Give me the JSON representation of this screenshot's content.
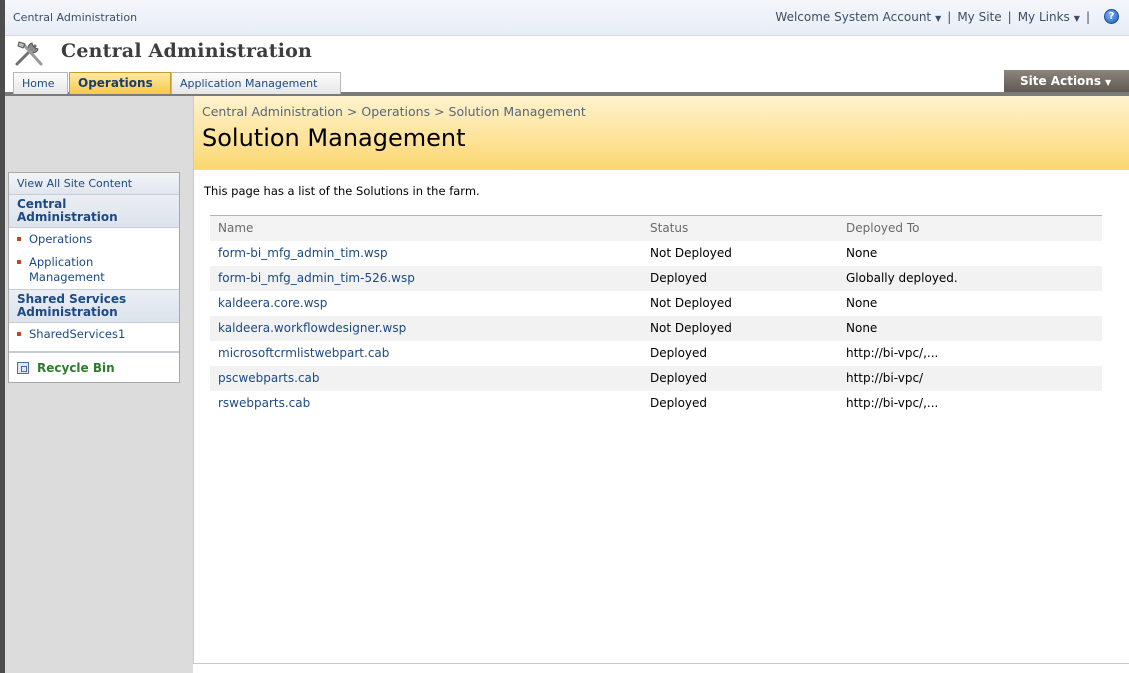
{
  "globalbar": {
    "site_name": "Central Administration",
    "welcome": "Welcome System Account",
    "my_site": "My Site",
    "my_links": "My Links",
    "separator": "|",
    "help_glyph": "?"
  },
  "header": {
    "title": "Central Administration",
    "logo_icon": "tools-icon"
  },
  "tabs": [
    {
      "label": "Home",
      "selected": false
    },
    {
      "label": "Operations",
      "selected": true
    },
    {
      "label": "Application Management",
      "selected": false
    }
  ],
  "site_actions": {
    "label": "Site Actions"
  },
  "sidebar": {
    "view_all": "View All Site Content",
    "sections": [
      {
        "header": "Central Administration",
        "items": [
          "Operations",
          "Application Management"
        ]
      },
      {
        "header": "Shared Services Administration",
        "items": [
          "SharedServices1"
        ]
      }
    ],
    "recycle_bin": "Recycle Bin"
  },
  "page": {
    "breadcrumb": "Central Administration > Operations > Solution Management",
    "title": "Solution Management",
    "description": "This page has a list of the Solutions in the farm."
  },
  "table": {
    "columns": [
      "Name",
      "Status",
      "Deployed To"
    ],
    "rows": [
      [
        "form-bi_mfg_admin_tim.wsp",
        "Not Deployed",
        "None"
      ],
      [
        "form-bi_mfg_admin_tim-526.wsp",
        "Deployed",
        "Globally deployed."
      ],
      [
        "kaldeera.core.wsp",
        "Not Deployed",
        "None"
      ],
      [
        "kaldeera.workflowdesigner.wsp",
        "Not Deployed",
        "None"
      ],
      [
        "microsoftcrmlistwebpart.cab",
        "Deployed",
        "http://bi-vpc/,..."
      ],
      [
        "pscwebparts.cab",
        "Deployed",
        "http://bi-vpc/"
      ],
      [
        "rswebparts.cab",
        "Deployed",
        "http://bi-vpc/,..."
      ]
    ]
  },
  "colors": {
    "link": "#1b4a84",
    "accent_tab": "#f7c94b",
    "bullet": "#c1461e"
  }
}
